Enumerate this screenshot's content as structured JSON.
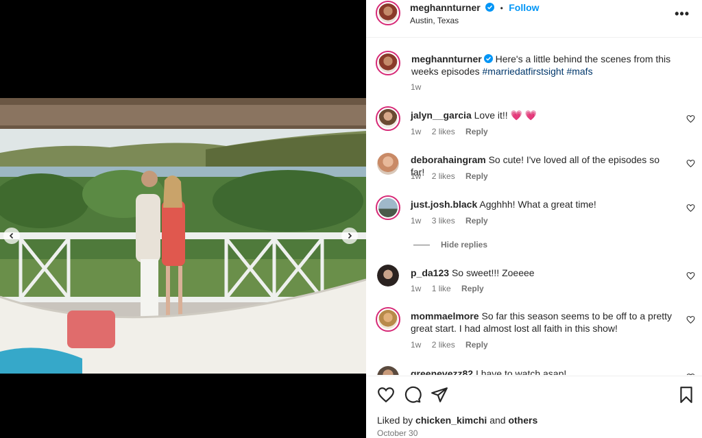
{
  "post": {
    "username": "meghannturner",
    "separator": "•",
    "follow_label": "Follow",
    "location": "Austin, Texas",
    "more_label": "•••",
    "caption": {
      "username": "meghannturner",
      "text": "Here's a little behind the scenes from this weeks episodes",
      "hashtags": "#marriedatfirstsight #mafs",
      "age": "1w"
    }
  },
  "comments": [
    {
      "username": "jalyn__garcia",
      "text": "Love it!!",
      "emoji": "💗 💗",
      "age": "1w",
      "likes": "2 likes",
      "reply_label": "Reply"
    },
    {
      "username": "deborahaingram",
      "text": "So cute! I've loved all of the episodes so far!",
      "age": "1w",
      "likes": "2 likes",
      "reply_label": "Reply"
    },
    {
      "username": "just.josh.black",
      "text": "Agghhh! What a great time!",
      "age": "1w",
      "likes": "3 likes",
      "reply_label": "Reply"
    },
    {
      "username": "p_da123",
      "text": "So sweet!!! Zoeeee",
      "age": "1w",
      "likes": "1 like",
      "reply_label": "Reply"
    },
    {
      "username": "mommaelmore",
      "text": "So far this season seems to be off to a pretty great start. I had almost lost all faith in this show!",
      "age": "1w",
      "likes": "2 likes",
      "reply_label": "Reply"
    },
    {
      "username": "greenevezz82",
      "text": "I have to watch asap!"
    }
  ],
  "hide_replies_label": "Hide replies",
  "footer": {
    "liked_prefix": "Liked by",
    "liked_user": "chicken_kimchi",
    "liked_and": "and",
    "liked_others": "others",
    "date": "October 30"
  },
  "colors": {
    "accent": "#0095f6",
    "story_ring": "#d62976",
    "hashtag": "#00376b",
    "muted": "#737373"
  },
  "icons": {
    "like": "heart-icon",
    "comment": "comment-icon",
    "share": "share-icon",
    "save": "bookmark-icon",
    "verified": "verified-badge-icon",
    "prev": "chevron-left-icon",
    "next": "chevron-right-icon"
  }
}
